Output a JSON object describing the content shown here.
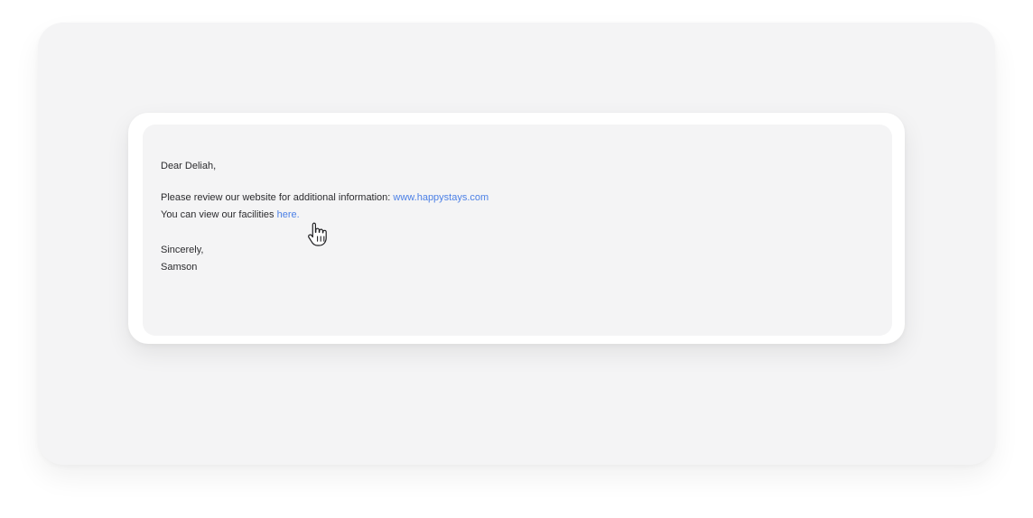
{
  "email": {
    "greeting": "Dear Deliah,",
    "review_text": "Please review our website for additional information: ",
    "website_link": "www.happystays.com",
    "facilities_text": "You can view our facilities ",
    "facilities_link": "here.",
    "closing": "Sincerely,",
    "signature": "Samson"
  },
  "colors": {
    "link": "#4c80e6",
    "background": "#f4f4f5",
    "card": "#ffffff"
  },
  "icons": {
    "cursor": "hand-pointer-icon"
  }
}
